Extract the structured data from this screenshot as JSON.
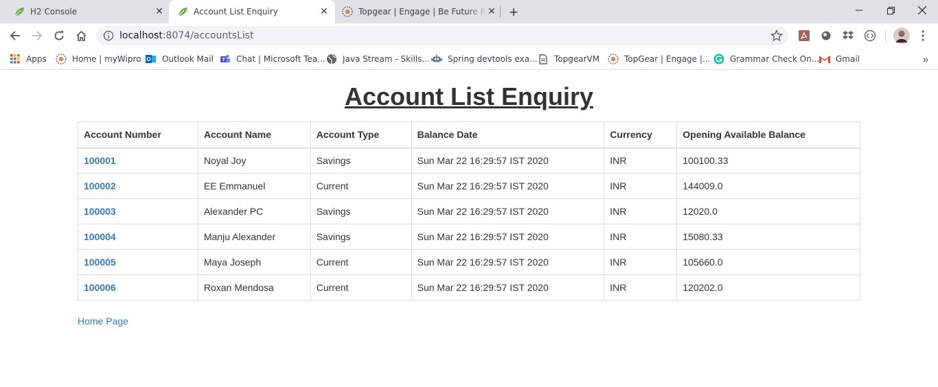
{
  "browser": {
    "tabs": [
      {
        "title": "H2 Console",
        "icon": "leaf-icon"
      },
      {
        "title": "Account List Enquiry",
        "icon": "leaf-icon"
      },
      {
        "title": "Topgear | Engage | Be Future Rea",
        "icon": "wipro-icon"
      }
    ],
    "new_tab": "+",
    "url_host": "localhost",
    "url_path": ":8074/accountsList"
  },
  "bookmarks": [
    {
      "label": "Apps",
      "icon": "apps-grid-icon"
    },
    {
      "label": "Home | myWipro",
      "icon": "wipro-icon"
    },
    {
      "label": "Outlook Mail",
      "icon": "outlook-icon"
    },
    {
      "label": "Chat | Microsoft Tea...",
      "icon": "teams-icon"
    },
    {
      "label": "Java Stream - Skills...",
      "icon": "globe-icon"
    },
    {
      "label": "Spring devtools exa...",
      "icon": "robot-icon"
    },
    {
      "label": "TopgearVM",
      "icon": "page-icon"
    },
    {
      "label": "TopGear | Engage |...",
      "icon": "wipro-icon"
    },
    {
      "label": "Grammar Check On...",
      "icon": "grammarly-icon"
    },
    {
      "label": "Gmail",
      "icon": "gmail-icon"
    }
  ],
  "page": {
    "title": "Account List Enquiry",
    "home_link": "Home Page"
  },
  "table": {
    "headers": [
      "Account Number",
      "Account Name",
      "Account Type",
      "Balance Date",
      "Currency",
      "Opening Available Balance"
    ],
    "rows": [
      [
        "100001",
        "Noyal Joy",
        "Savings",
        "Sun Mar 22 16:29:57 IST 2020",
        "INR",
        "100100.33"
      ],
      [
        "100002",
        "EE Emmanuel",
        "Current",
        "Sun Mar 22 16:29:57 IST 2020",
        "INR",
        "144009.0"
      ],
      [
        "100003",
        "Alexander PC",
        "Savings",
        "Sun Mar 22 16:29:57 IST 2020",
        "INR",
        "12020.0"
      ],
      [
        "100004",
        "Manju Alexander",
        "Savings",
        "Sun Mar 22 16:29:57 IST 2020",
        "INR",
        "15080.33"
      ],
      [
        "100005",
        "Maya Joseph",
        "Current",
        "Sun Mar 22 16:29:57 IST 2020",
        "INR",
        "105660.0"
      ],
      [
        "100006",
        "Roxan Mendosa",
        "Current",
        "Sun Mar 22 16:29:57 IST 2020",
        "INR",
        "120202.0"
      ]
    ]
  },
  "colors": {
    "link": "#337ab7",
    "text": "#333333",
    "tabstrip": "#dee1e6"
  }
}
